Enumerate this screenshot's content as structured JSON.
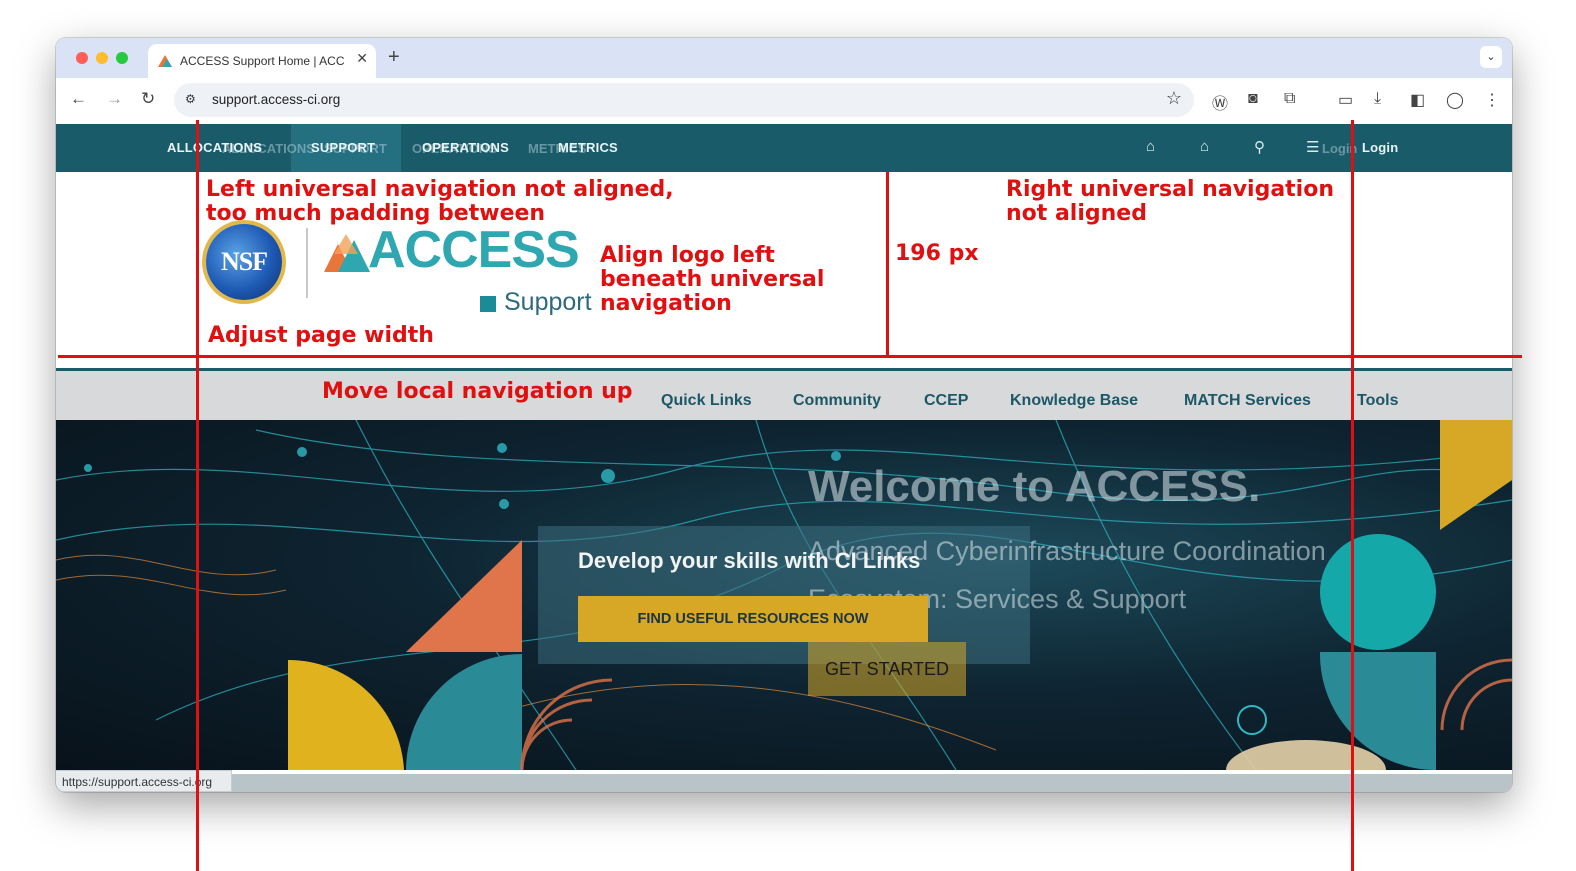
{
  "browser": {
    "tab_title": "ACCESS Support Home | ACC",
    "new_tab_label": "+",
    "tab_menu": "⌄",
    "url": "support.access-ci.org",
    "status_url": "https://support.access-ci.org"
  },
  "universal_nav": {
    "items": [
      "ALLOCATIONS",
      "SUPPORT",
      "OPERATIONS",
      "METRICS"
    ],
    "ghost_items": [
      "ALLOCATIONS",
      "SUPPORT",
      "OPERATIONS",
      "METRICS"
    ],
    "login": "Login",
    "ghost_login": "Login"
  },
  "header": {
    "nsf_text": "NSF",
    "access_text": "ACCESS",
    "support_text": "Support"
  },
  "local_nav": {
    "items": [
      "Quick Links",
      "Community",
      "CCEP",
      "Knowledge Base",
      "MATCH Services",
      "Tools"
    ]
  },
  "hero": {
    "skills_heading": "Develop your skills with CI Links",
    "skills_button": "FIND USEFUL RESOURCES NOW",
    "welcome": "Welcome to ACCESS.",
    "subtitle_line1": "Advanced Cyberinfrastructure Coordination",
    "subtitle_line2": "Ecosystem: Services & Support",
    "get_started": "GET STARTED"
  },
  "annotations": {
    "left_nav_line1": "Left universal navigation not aligned,",
    "left_nav_line2": "too much padding between",
    "align_logo_1": "Align logo left",
    "align_logo_2": "beneath universal",
    "align_logo_3": "navigation",
    "page_width": "Adjust page width",
    "px196": "196 px",
    "right_nav_1": "Right universal navigation",
    "right_nav_2": "not aligned",
    "move_local": "Move local navigation up"
  },
  "colors": {
    "universal_nav_bg": "#1a5b6a",
    "annotation_red": "#e01010",
    "accent_gold": "#d7a826",
    "access_teal": "#2fa7b0"
  }
}
